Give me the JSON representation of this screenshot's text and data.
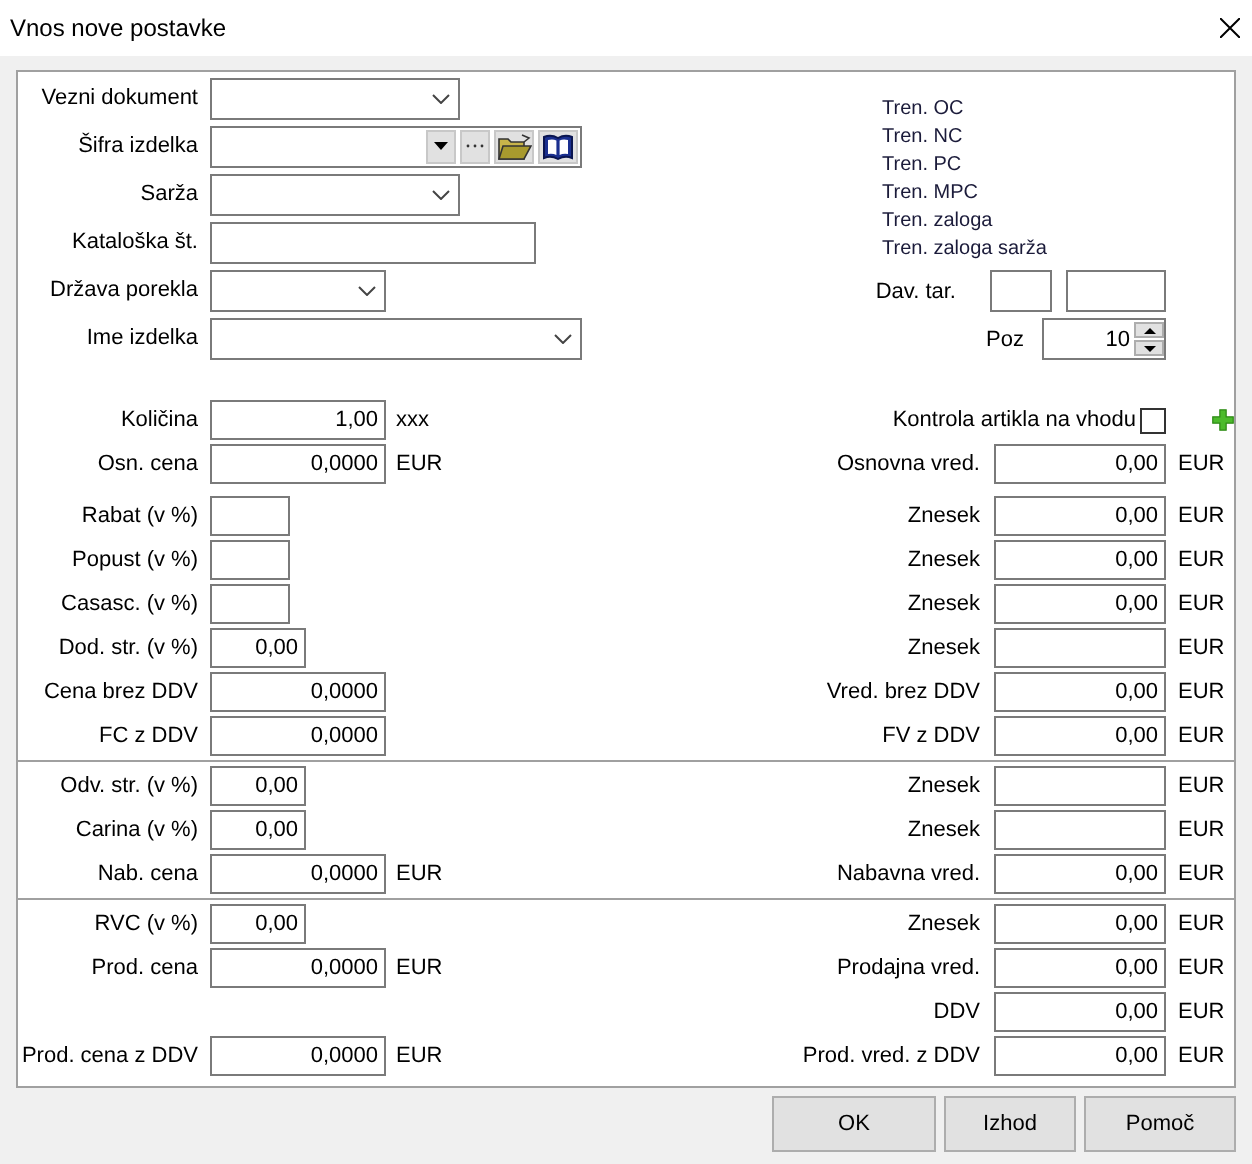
{
  "window": {
    "title": "Vnos nove postavke"
  },
  "header_fields": [
    {
      "label": "Vezni dokument",
      "kind": "combo"
    },
    {
      "label": "Šifra izdelka",
      "kind": "lookup"
    },
    {
      "label": "Sarža",
      "kind": "combo"
    },
    {
      "label": "Kataloška št.",
      "kind": "text"
    },
    {
      "label": "Država porekla",
      "kind": "combo_short"
    },
    {
      "label": "Ime izdelka",
      "kind": "combo_long"
    }
  ],
  "current_info": [
    "Tren. OC",
    "Tren. NC",
    "Tren. PC",
    "Tren. MPC",
    "Tren. zaloga",
    "Tren. zaloga sarža"
  ],
  "tariff": {
    "label": "Dav. tar."
  },
  "position": {
    "label": "Poz",
    "value": "10"
  },
  "quantity_row": {
    "left": {
      "label": "Količina",
      "value": "1,00",
      "unit": "xxx",
      "kind": "wide"
    },
    "check": {
      "label": "Kontrola artikla na vhodu",
      "checked": false
    }
  },
  "sections": [
    [
      {
        "left": {
          "label": "Osn. cena",
          "value": "0,0000",
          "unit": "EUR",
          "kind": "wide"
        },
        "right": {
          "label": "Osnovna vred.",
          "value": "0,00",
          "unit": "EUR"
        }
      },
      {
        "left": {
          "label": "Rabat (v %)",
          "kind": "narrow"
        },
        "right": {
          "label": "Znesek",
          "value": "0,00",
          "unit": "EUR"
        }
      },
      {
        "left": {
          "label": "Popust (v %)",
          "kind": "narrow"
        },
        "right": {
          "label": "Znesek",
          "value": "0,00",
          "unit": "EUR"
        }
      },
      {
        "left": {
          "label": "Casasc. (v %)",
          "kind": "narrow"
        },
        "right": {
          "label": "Znesek",
          "value": "0,00",
          "unit": "EUR"
        }
      },
      {
        "left": {
          "label": "Dod. str. (v %)",
          "value": "0,00",
          "kind": "medium"
        },
        "right": {
          "label": "Znesek",
          "unit": "EUR"
        }
      },
      {
        "left": {
          "label": "Cena brez DDV",
          "value": "0,0000",
          "kind": "wide"
        },
        "right": {
          "label": "Vred. brez DDV",
          "value": "0,00",
          "unit": "EUR"
        }
      },
      {
        "left": {
          "label": "FC z DDV",
          "value": "0,0000",
          "kind": "wide"
        },
        "right": {
          "label": "FV z DDV",
          "value": "0,00",
          "unit": "EUR"
        }
      }
    ],
    [
      {
        "left": {
          "label": "Odv. str. (v %)",
          "value": "0,00",
          "kind": "medium"
        },
        "right": {
          "label": "Znesek",
          "unit": "EUR"
        }
      },
      {
        "left": {
          "label": "Carina (v %)",
          "value": "0,00",
          "kind": "medium"
        },
        "right": {
          "label": "Znesek",
          "unit": "EUR"
        }
      },
      {
        "left": {
          "label": "Nab. cena",
          "value": "0,0000",
          "unit": "EUR",
          "kind": "wide"
        },
        "right": {
          "label": "Nabavna vred.",
          "value": "0,00",
          "unit": "EUR"
        }
      }
    ],
    [
      {
        "left": {
          "label": "RVC (v %)",
          "value": "0,00",
          "kind": "medium"
        },
        "right": {
          "label": "Znesek",
          "value": "0,00",
          "unit": "EUR"
        }
      },
      {
        "left": {
          "label": "Prod. cena",
          "value": "0,0000",
          "unit": "EUR",
          "kind": "wide"
        },
        "right": {
          "label": "Prodajna vred.",
          "value": "0,00",
          "unit": "EUR"
        }
      },
      {
        "right": {
          "label": "DDV",
          "value": "0,00",
          "unit": "EUR"
        }
      },
      {
        "left": {
          "label": "Prod. cena z DDV",
          "value": "0,0000",
          "unit": "EUR",
          "kind": "wide"
        },
        "right": {
          "label": "Prod. vred. z DDV",
          "value": "0,00",
          "unit": "EUR"
        }
      }
    ]
  ],
  "buttons": [
    "OK",
    "Izhod",
    "Pomoč"
  ]
}
